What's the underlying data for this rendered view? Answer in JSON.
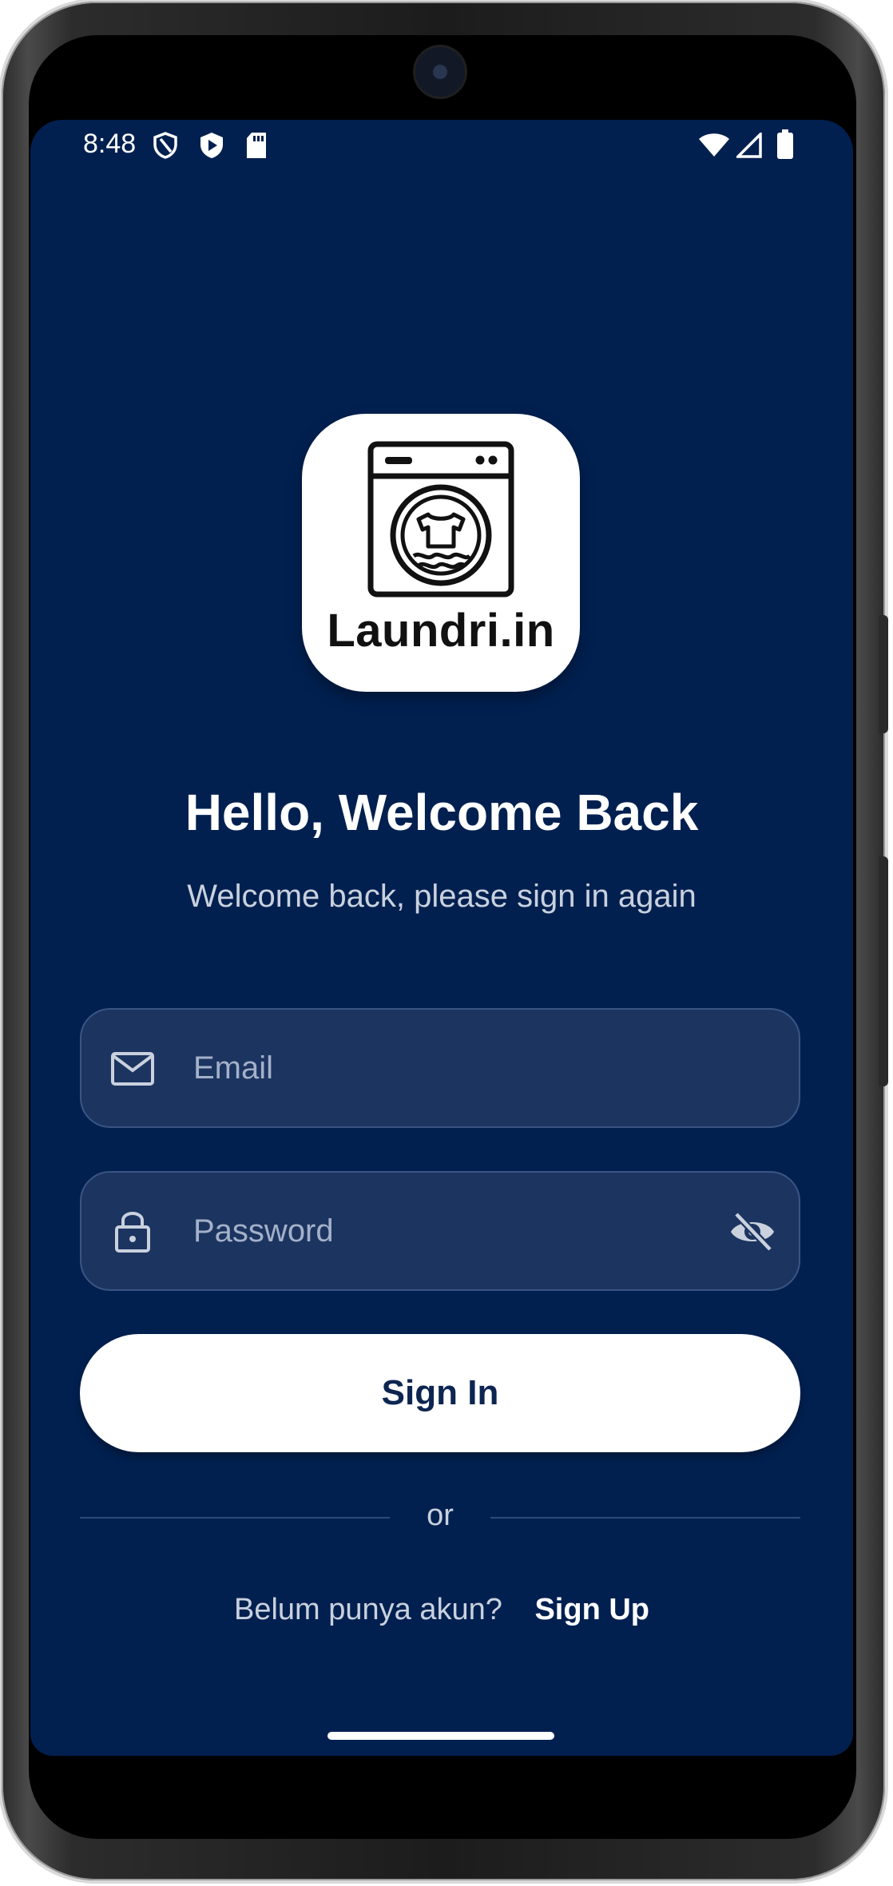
{
  "status_bar": {
    "time": "8:48",
    "left_icons": [
      "shield-outline-icon",
      "shield-play-icon",
      "sd-card-icon"
    ],
    "right_icons": [
      "wifi-icon",
      "signal-icon",
      "battery-icon"
    ]
  },
  "logo": {
    "text": "Laundri.in",
    "icon": "washing-machine-icon"
  },
  "header": {
    "title": "Hello, Welcome Back",
    "subtitle": "Welcome back, please sign in again"
  },
  "form": {
    "email": {
      "placeholder": "Email",
      "value": "",
      "icon": "mail-icon"
    },
    "password": {
      "placeholder": "Password",
      "value": "",
      "icon": "lock-icon",
      "toggle_icon": "eye-off-icon"
    },
    "sign_in_label": "Sign In"
  },
  "divider": {
    "text": "or"
  },
  "signup": {
    "prompt": "Belum punya akun?",
    "link_label": "Sign Up"
  },
  "colors": {
    "background": "#012050",
    "field_background": "#1c3460",
    "button_background": "#ffffff",
    "button_text": "#0d2551"
  }
}
